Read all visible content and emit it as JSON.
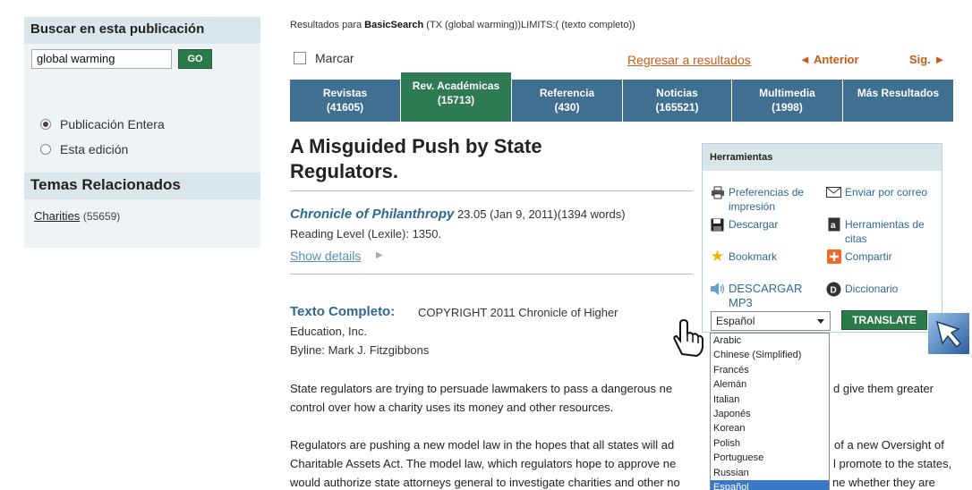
{
  "left_panel": {
    "search_title": "Buscar en esta publicación",
    "search_value": "global warming",
    "go_label": "GO",
    "radio_options": [
      {
        "label": "Publicación Entera",
        "checked": true
      },
      {
        "label": "Esta edición",
        "checked": false
      }
    ],
    "temas_title": "Temas Relacionados",
    "topic": {
      "label": "Charities",
      "count": "(55659)"
    }
  },
  "header": {
    "results_prefix": "Resultados para ",
    "results_bold": "BasicSearch",
    "results_query": " (TX (global warming))LIMITS:( (texto completo))",
    "marcar": "Marcar",
    "regresar": "Regresar a resultados",
    "anterior": "◄ Anterior",
    "sig": "Sig. ►"
  },
  "tabs": [
    {
      "label": "Revistas",
      "count": "(41605)",
      "active": false
    },
    {
      "label": "Rev. Académicas",
      "count": "(15713)",
      "active": true
    },
    {
      "label": "Referencia",
      "count": "(430)",
      "active": false
    },
    {
      "label": "Noticias",
      "count": "(165521)",
      "active": false
    },
    {
      "label": "Multimedia",
      "count": "(1998)",
      "active": false
    },
    {
      "label": "Más Resultados",
      "count": "",
      "active": false
    }
  ],
  "article": {
    "title_line1": "A Misguided Push by State",
    "title_line2": "Regulators.",
    "publication": "Chronicle of Philanthropy",
    "pub_details": " 23.05 (Jan 9, 2011)(1394 words)",
    "reading_level": "Reading Level (Lexile): 1350.",
    "show_details": "Show details",
    "texto_label": "Texto Completo:",
    "texto_value1": "COPYRIGHT 2011 Chronicle of Higher",
    "texto_value2": "Education, Inc.",
    "byline": "Byline: Mark J. Fitzgibbons",
    "para1_line1": "State regulators are trying to persuade lawmakers to pass a dangerous ne",
    "para1_line1_end": "d give them greater",
    "para1_line2": "control over how a charity uses its money and other resources.",
    "para2_line1": "Regulators are pushing a new model law in the hopes that all states will ad",
    "para2_line1_end": "of a new Oversight of",
    "para2_line2": "Charitable Assets Act. The model law, which regulators hope to approve ne",
    "para2_line2_end": "l promote to the states,",
    "para2_line3": "would authorize state attorneys general to investigate charities and other no",
    "para2_line3_end": "ne whether they are"
  },
  "tools": {
    "title": "Herramientas",
    "items": {
      "print_prefs": "Preferencias de impresión",
      "email": "Enviar por correo",
      "download": "Descargar",
      "cite": "Herramientas de citas",
      "bookmark": "Bookmark",
      "share": "Compartir",
      "mp3": "DESCARGAR MP3",
      "dictionary": "Diccionario"
    },
    "language_selected": "Español",
    "translate_label": "TRANSLATE",
    "languages": [
      "Arabic",
      "Chinese (Simplified)",
      "Francés",
      "Alemán",
      "Italian",
      "Japonés",
      "Korean",
      "Polish",
      "Portuguese",
      "Russian",
      "Español"
    ]
  }
}
